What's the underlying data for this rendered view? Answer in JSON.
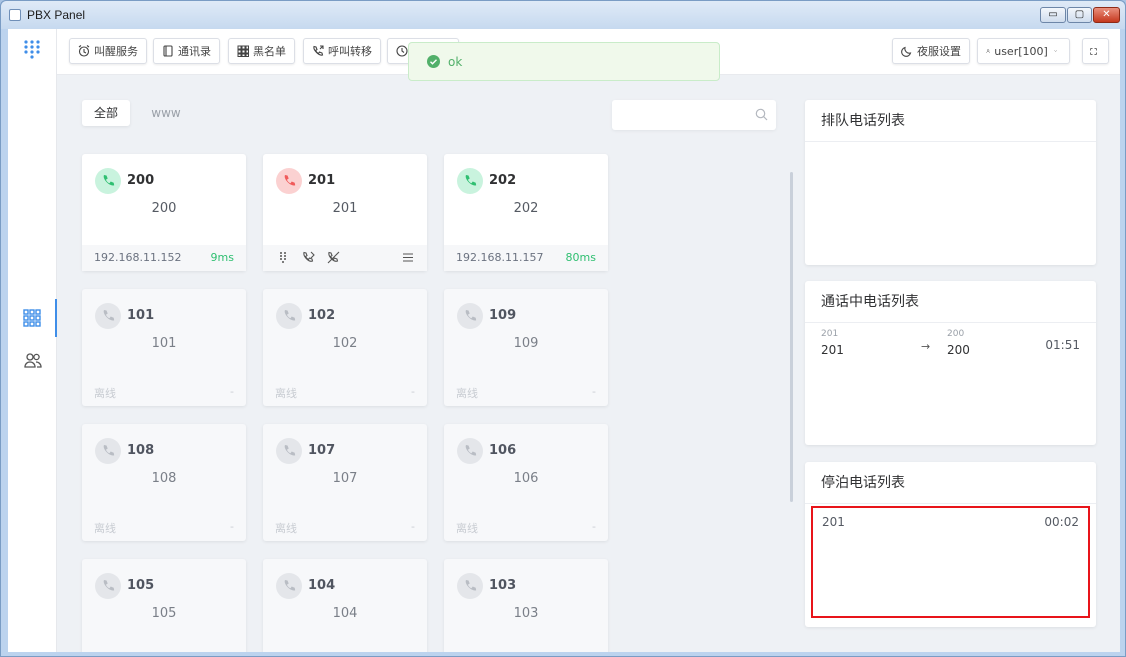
{
  "window": {
    "title": "PBX Panel",
    "controls": {
      "minimize": "▭",
      "maximize": "▢",
      "close": "✕"
    }
  },
  "toolbar": {
    "buttons": [
      {
        "label": "叫醒服务",
        "icon": "alarm-clock-icon"
      },
      {
        "label": "通讯录",
        "icon": "book-icon"
      },
      {
        "label": "黑名单",
        "icon": "grid-icon"
      },
      {
        "label": "呼叫转移",
        "icon": "phone-forward-icon"
      }
    ],
    "night": {
      "label": "夜服设置",
      "icon": "moon-icon"
    },
    "user": {
      "label": "user[100]",
      "icon": "user-icon"
    },
    "fullscreen_icon": "fullscreen-icon"
  },
  "toast": {
    "text": "ok",
    "type": "success",
    "color": "#52b06a"
  },
  "tabs": [
    {
      "label": "全部",
      "active": true
    },
    {
      "label": "www",
      "active": false
    }
  ],
  "search": {
    "placeholder": ""
  },
  "extensions": [
    {
      "number": "200",
      "name": "200",
      "state": "idle",
      "ip": "192.168.11.152",
      "latency": "9ms"
    },
    {
      "number": "201",
      "name": "201",
      "state": "parked"
    },
    {
      "number": "202",
      "name": "202",
      "state": "idle",
      "ip": "192.168.11.157",
      "latency": "80ms"
    },
    {
      "number": "101",
      "name": "101",
      "state": "offline",
      "status": "离线",
      "dash": "-"
    },
    {
      "number": "102",
      "name": "102",
      "state": "offline",
      "status": "离线",
      "dash": "-"
    },
    {
      "number": "109",
      "name": "109",
      "state": "offline",
      "status": "离线",
      "dash": "-"
    },
    {
      "number": "108",
      "name": "108",
      "state": "offline",
      "status": "离线",
      "dash": "-"
    },
    {
      "number": "107",
      "name": "107",
      "state": "offline",
      "status": "离线",
      "dash": "-"
    },
    {
      "number": "106",
      "name": "106",
      "state": "offline",
      "status": "离线",
      "dash": "-"
    },
    {
      "number": "105",
      "name": "105",
      "state": "offline"
    },
    {
      "number": "104",
      "name": "104",
      "state": "offline"
    },
    {
      "number": "103",
      "name": "103",
      "state": "offline"
    }
  ],
  "panels": {
    "queue": {
      "title": "排队电话列表"
    },
    "active": {
      "title": "通话中电话列表",
      "calls": [
        {
          "from_small": "201",
          "from": "201",
          "to_small": "200",
          "to": "200",
          "duration": "01:51"
        }
      ]
    },
    "parked": {
      "title": "停泊电话列表",
      "calls": [
        {
          "number": "201",
          "duration": "00:02"
        }
      ],
      "highlight_color": "#e8141a"
    }
  },
  "colors": {
    "accent": "#3f8ee8",
    "online": "#2fbf71",
    "busy": "#f05a5a",
    "offline": "#c0c4cc"
  }
}
